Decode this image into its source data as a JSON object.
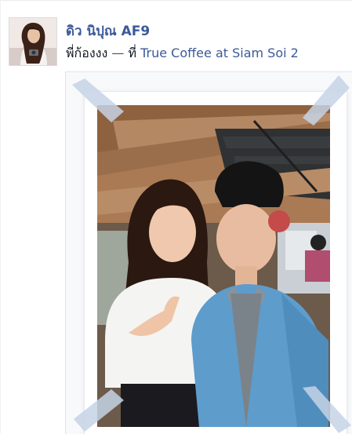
{
  "post": {
    "author": "ดิว นิปุณ AF9",
    "text": "พี่ก้องงง",
    "separator": "—",
    "location_prefix": "ที่",
    "location": "True Coffee at Siam Soi 2"
  },
  "icons": {
    "avatar": "profile-photo",
    "photo": "shared-photo"
  },
  "colors": {
    "link": "#3b5998",
    "text": "#141823",
    "tape": "#c6d3e5"
  }
}
